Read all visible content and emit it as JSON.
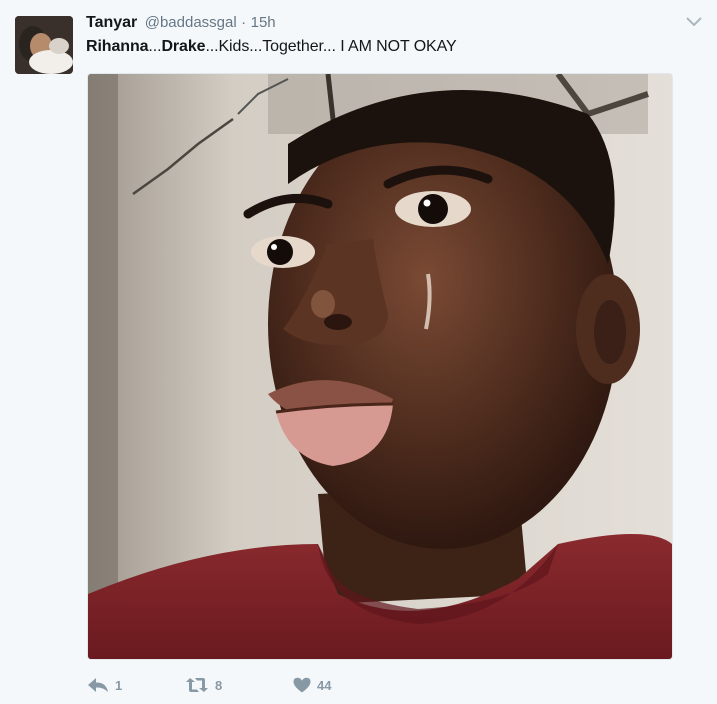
{
  "tweet": {
    "author_name": "Tanyar",
    "author_handle": "@baddassgal",
    "separator": "·",
    "timestamp": "15h",
    "text": {
      "part1": "Rihanna",
      "part2": "...",
      "part3": "Drake",
      "part4": "...Kids...Together... I AM NOT OKAY"
    },
    "media": {
      "kind": "photo",
      "description_icon": "photo-of-person-crying"
    }
  },
  "actions": {
    "reply": {
      "icon": "reply-icon",
      "count": "1"
    },
    "retweet": {
      "icon": "retweet-icon",
      "count": "8"
    },
    "like": {
      "icon": "heart-icon",
      "count": "44"
    }
  },
  "colors": {
    "background": "#f5f8fa",
    "muted": "#657786",
    "action": "#8899a6",
    "sweater": "#7d2327"
  }
}
